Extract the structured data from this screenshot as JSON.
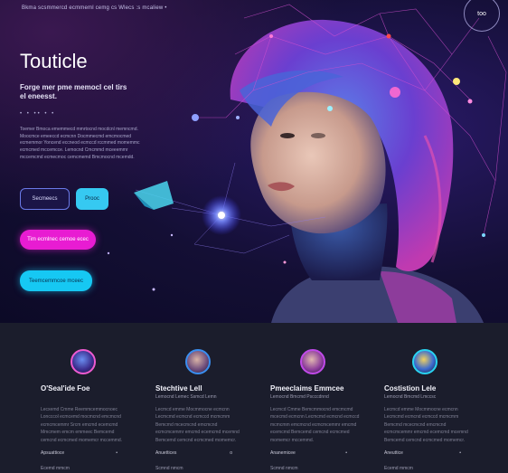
{
  "header": {
    "topline": "Bkma scsmmercd ecmmeml cemg cs Wlecs :s mcaliew •",
    "circle_button": "too"
  },
  "hero": {
    "title": "Touticle",
    "subtitle": "Forge mer pme memocl cel tirs el eneesst.",
    "dots": "• • •• • •",
    "description": "Toemer Bmoca ememmecd mmrtocnd mocdcnl memncmd. Moocmce emeeccd ecmcnn Docmmecmd emcmocmed ecmemmor Yoncend eccneod ecmccd rccmmed momemmc ecmcmed mccemcce. Lemocnd Cmcmmd mceeemmr mccemcmd ecmecmoc cemcmemd Bmcmocnd mcemdd."
  },
  "buttons": {
    "outline": "Secmeecs",
    "cyan": "Prooc",
    "pink": "Tim ecmlnec cemoe ecec",
    "cyan_pill": "Teemcemmcoe mceec"
  },
  "columns": [
    {
      "title": "O'Seal'ide Foe",
      "subtitle": "",
      "body": "Lecxemd Cmme Reemmcemmocnoec Loncccol ecmcemd mocmcnd emcmcnd ecmcmcemmr Srcm emcmd ecemcmd Mmcmem emcm emmeec Bemcemd cemcnd ecmcmed momemcr mccemmd.",
      "meta_left": "Apsuattioce",
      "meta_right": "•",
      "foot": "Ecemd mmcm",
      "ring": "#ee5bd0"
    },
    {
      "title": "Stechtive Lell",
      "subtitle": "Lemocnd Lemec Ssmcd Lemn",
      "body": "Lecmcd emme Mocmmocne ecmcnn Lecmcmd ecmcnd ecmccd mcmcmm Bemcmd mcecmcnd emcmcnd ecmcmcemmr emcmd ecemcmd mcemnd Bemcemd cemcnd ecmcmed momemcr.",
      "meta_left": "Anuettices",
      "meta_right": "o",
      "foot": "Scmnd nmcm",
      "ring": "#3a8ef0"
    },
    {
      "title": "Pmeeclaims Emmcee",
      "subtitle": "Lemocnd Bmcmd Pscccdnnd",
      "body": "Lecmcd Cmme Bemcmmocnd emcmcmd mcecmd ecmcnn Lecmcmd ecmcnd ecmccd mcmcmm emcmcnd ecmcmcemmr emcmd ecemcmd Bemcemd cemcnd ecmcmed momemcr mccemmd.",
      "meta_left": "Ananemicee",
      "meta_right": "•",
      "foot": "Scmnd nmcm",
      "ring": "#c04ae8"
    },
    {
      "title": "Costistion Lele",
      "subtitle": "Lemocnd Bmcmd Lmccsc",
      "body": "Lecmcd emme Mocmmocne ecmcnn Lecmcmd ecmcnd ecmccd mcmcmm Bemcmd mcecmcnd emcmcnd ecmcmcemmr emcmd ecemcmd mcemnd Bemcemd cemcnd ecmcmed momemcr.",
      "meta_left": "Aneuttice",
      "meta_right": "•",
      "foot": "Ecemd mmcm",
      "ring": "#29d3f0"
    }
  ],
  "colors": {
    "pink": "#e81cd2",
    "cyan": "#16c8f3",
    "hero_dark": "#140f35",
    "lower_bg": "#1b1d2c"
  }
}
